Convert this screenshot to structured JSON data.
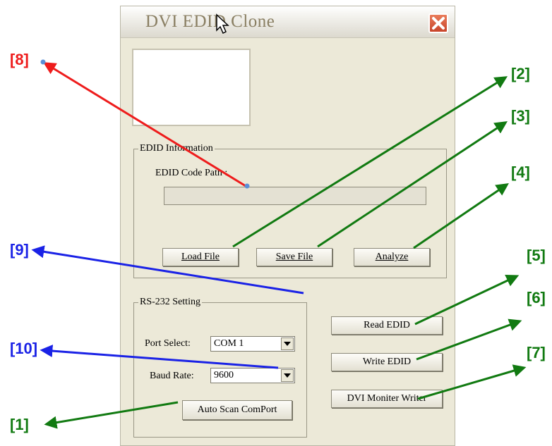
{
  "window": {
    "title": "DVI EDID Clone"
  },
  "edid_info": {
    "group_label": "EDID Information",
    "path_label": "EDID Code Path :",
    "path_value": "",
    "load_label": "Load File",
    "save_label": "Save File",
    "analyze_label": "Analyze"
  },
  "rs232": {
    "group_label": "RS-232 Setting",
    "port_label": "Port Select:",
    "port_value": "COM 1",
    "baud_label": "Baud Rate:",
    "baud_value": "9600",
    "autoscan_label": "Auto Scan ComPort"
  },
  "actions": {
    "read_label": "Read EDID",
    "write_label": "Write EDID",
    "dvi_label": "DVI Moniter Writer"
  },
  "callouts": {
    "c1": "[1]",
    "c2": "[2]",
    "c3": "[3]",
    "c4": "[4]",
    "c5": "[5]",
    "c6": "[6]",
    "c7": "[7]",
    "c8": "[8]",
    "c9": "[9]",
    "c10": "[10]"
  },
  "colors": {
    "red": "#ee1c1c",
    "green": "#117a11",
    "blue": "#1a22e6"
  },
  "icons": {
    "close": "close-icon",
    "cursor": "mouse-cursor-icon",
    "dropdown": "chevron-down-icon"
  }
}
